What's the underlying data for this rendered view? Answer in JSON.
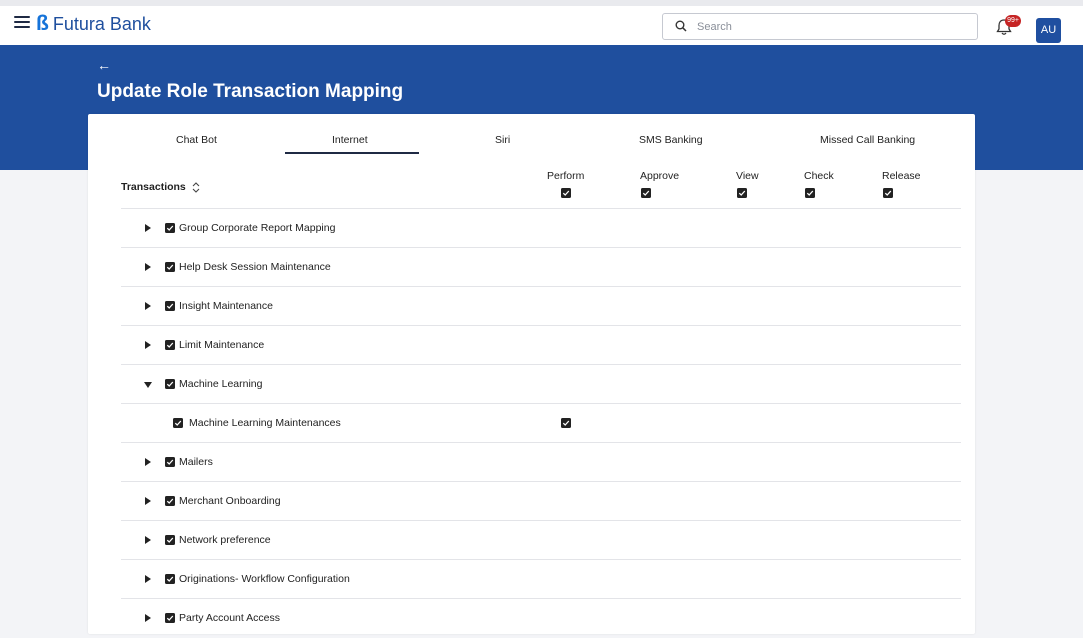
{
  "brand": {
    "logo_mark": "ß",
    "name": "Futura Bank"
  },
  "search": {
    "placeholder": "Search"
  },
  "notifications": {
    "badge": "99+"
  },
  "user": {
    "initials": "AU"
  },
  "page": {
    "back_symbol": "←",
    "title": "Update Role Transaction Mapping"
  },
  "tabs": [
    {
      "label": "Chat Bot",
      "active": false
    },
    {
      "label": "Internet",
      "active": true
    },
    {
      "label": "Siri",
      "active": false
    },
    {
      "label": "SMS Banking",
      "active": false
    },
    {
      "label": "Missed Call Banking",
      "active": false
    }
  ],
  "table": {
    "transactions_header": "Transactions",
    "columns": [
      {
        "label": "Perform",
        "checked": true
      },
      {
        "label": "Approve",
        "checked": true
      },
      {
        "label": "View",
        "checked": true
      },
      {
        "label": "Check",
        "checked": true
      },
      {
        "label": "Release",
        "checked": true
      }
    ],
    "rows": [
      {
        "label": "Group Corporate Report Mapping",
        "expanded": false,
        "checked": true
      },
      {
        "label": "Help Desk Session Maintenance",
        "expanded": false,
        "checked": true
      },
      {
        "label": "Insight Maintenance",
        "expanded": false,
        "checked": true
      },
      {
        "label": "Limit Maintenance",
        "expanded": false,
        "checked": true
      },
      {
        "label": "Machine Learning",
        "expanded": true,
        "checked": true
      },
      {
        "label": "Machine Learning Maintenances",
        "sub": true,
        "checked": true,
        "perform_checked": true
      },
      {
        "label": "Mailers",
        "expanded": false,
        "checked": true
      },
      {
        "label": "Merchant Onboarding",
        "expanded": false,
        "checked": true
      },
      {
        "label": "Network preference",
        "expanded": false,
        "checked": true
      },
      {
        "label": "Originations- Workflow Configuration",
        "expanded": false,
        "checked": true
      },
      {
        "label": "Party Account Access",
        "expanded": false,
        "checked": true
      }
    ]
  },
  "colors": {
    "brand_blue": "#1f4f9e",
    "logo_blue": "#1573d9",
    "badge_red": "#c62424",
    "checkbox": "#222222"
  }
}
